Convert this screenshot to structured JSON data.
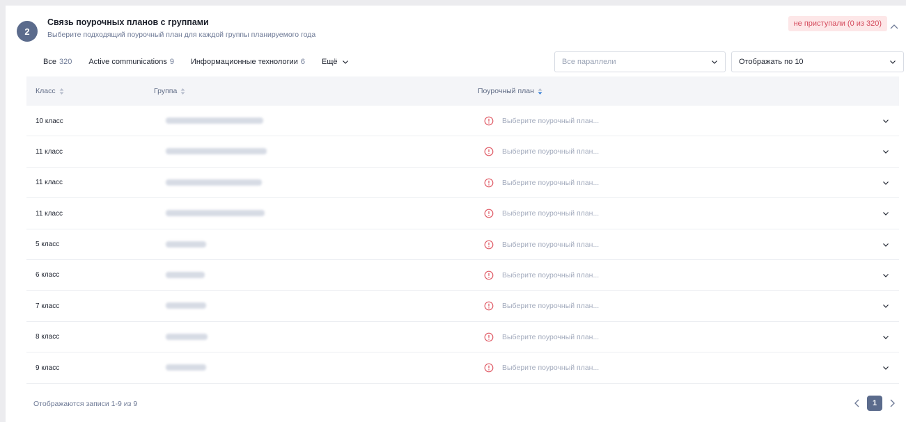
{
  "section": {
    "step": "2",
    "title": "Связь поурочных планов с группами",
    "subtitle": "Выберите подходящий поурочный план для каждой группы планируемого года",
    "status": "не приступали (0 из 320)"
  },
  "filters": [
    {
      "label": "Все",
      "count": "320"
    },
    {
      "label": "Active communications",
      "count": "9"
    },
    {
      "label": "Информационные технологии",
      "count": "6"
    },
    {
      "label": "Ещё",
      "count": ""
    }
  ],
  "selects": {
    "parallels_placeholder": "Все параллели",
    "per_page": "Отображать по 10"
  },
  "table": {
    "headers": [
      "Класс",
      "Группа",
      "Поурочный план"
    ],
    "plan_placeholder": "Выберите поурочный план...",
    "rows": [
      {
        "class": "10 класс"
      },
      {
        "class": "11 класс"
      },
      {
        "class": "11 класс"
      },
      {
        "class": "11 класс"
      },
      {
        "class": "5 класс"
      },
      {
        "class": "6 класс"
      },
      {
        "class": "7 класс"
      },
      {
        "class": "8 класс"
      },
      {
        "class": "9 класс"
      }
    ]
  },
  "footer": {
    "records": "Отображаются записи 1-9 из 9",
    "current_page": "1"
  },
  "colors": {
    "accent": "#5b6b8c",
    "status_bg": "#fde7e8",
    "status_text": "#d4495b",
    "warning": "#e05c67"
  }
}
